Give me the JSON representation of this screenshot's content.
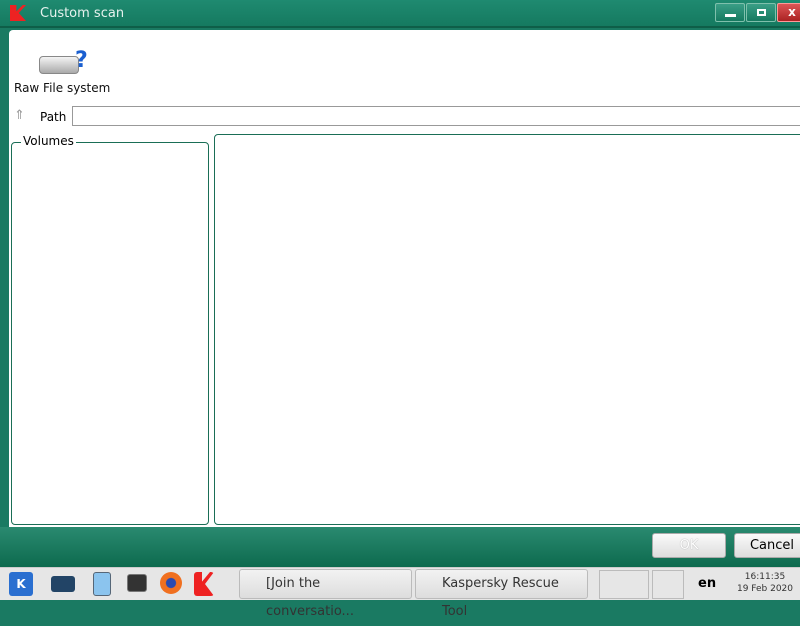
{
  "window": {
    "title": "Custom scan",
    "minimize": "minimize",
    "maximize": "maximize",
    "close": "x"
  },
  "toolbar": {
    "raw_label": "Raw File system"
  },
  "path": {
    "label": "Path",
    "value": ""
  },
  "volumes": {
    "label": "Volumes"
  },
  "buttons": {
    "ok": "OK",
    "cancel": "Cancel"
  },
  "taskbar": {
    "tasks": [
      "[Join the conversatio...",
      "Kaspersky Rescue Tool"
    ],
    "lang": "en",
    "time": "16:11:35",
    "date": "19 Feb 2020"
  }
}
